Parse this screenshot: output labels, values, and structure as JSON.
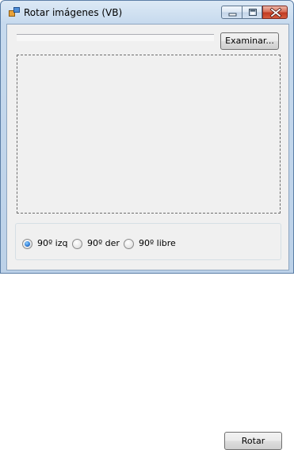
{
  "window": {
    "title": "Rotar imágenes (VB)",
    "icon": "app-window-icon"
  },
  "controls": {
    "minimize_icon": "minimize-icon",
    "maximize_icon": "maximize-icon",
    "close_icon": "close-icon"
  },
  "file": {
    "path_value": "",
    "browse_label": "Examinar..."
  },
  "rotation": {
    "options": [
      {
        "label": "90º izq",
        "checked": true
      },
      {
        "label": "90º der",
        "checked": false
      },
      {
        "label": "90º libre",
        "checked": false
      }
    ],
    "rotate_label": "Rotar"
  },
  "colors": {
    "title_bar": "#c7daee",
    "client_bg": "#f0f0f0",
    "close_button": "#c13b22",
    "radio_selected": "#2d7ad6"
  }
}
